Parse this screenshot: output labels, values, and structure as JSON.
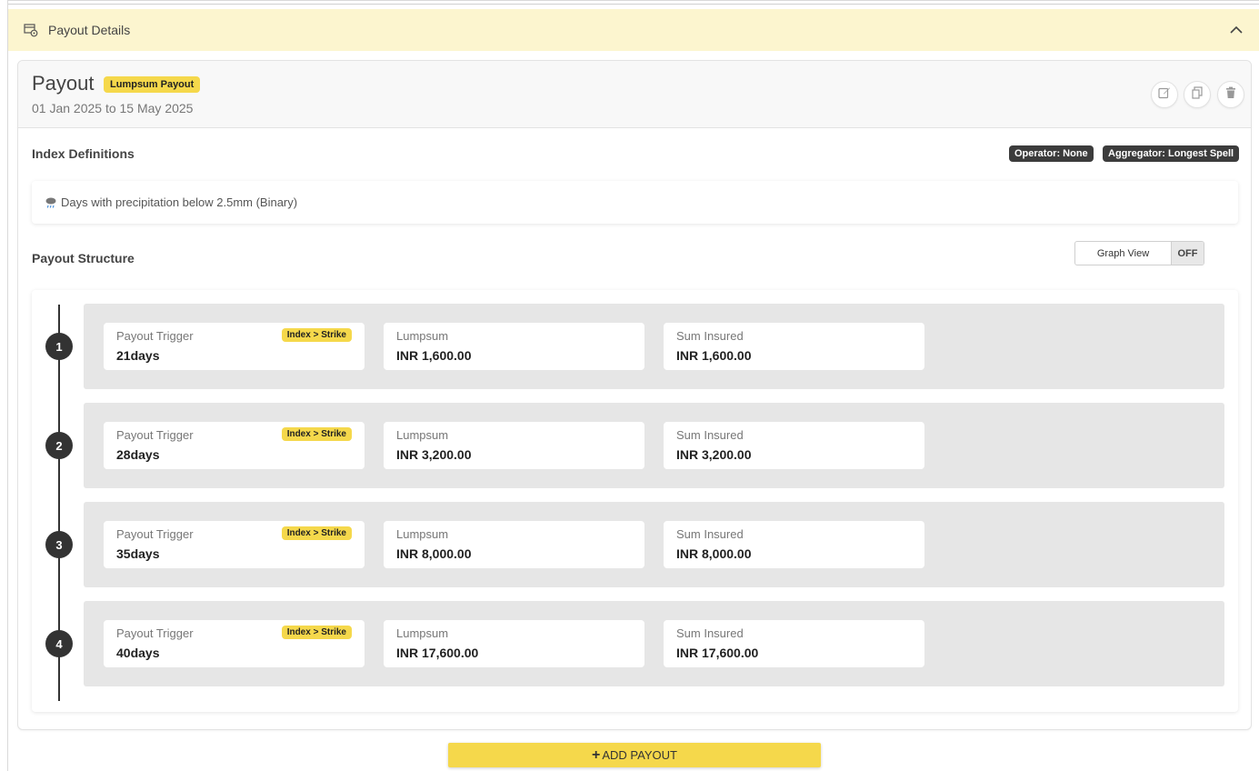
{
  "section": {
    "title": "Payout Details",
    "icon": "payout-settings-icon",
    "collapse_icon": "chevron-up-icon"
  },
  "payout": {
    "title": "Payout",
    "type_badge": "Lumpsum Payout",
    "date_range": "01 Jan 2025 to 15 May 2025",
    "actions": [
      {
        "name": "edit",
        "icon": "edit-icon"
      },
      {
        "name": "duplicate",
        "icon": "copy-icon"
      },
      {
        "name": "delete",
        "icon": "trash-icon"
      }
    ]
  },
  "index_definitions": {
    "title": "Index Definitions",
    "operator_badge": "Operator: None",
    "aggregator_badge": "Aggregator: Longest Spell",
    "definition_text": "Days with precipitation below 2.5mm (Binary)",
    "definition_icon": "rain-cloud-icon"
  },
  "payout_structure": {
    "title": "Payout Structure",
    "graph_view_label": "Graph View",
    "graph_view_state": "OFF",
    "field_labels": {
      "trigger": "Payout Trigger",
      "lumpsum": "Lumpsum",
      "sum_insured": "Sum Insured"
    },
    "trigger_badge": "Index > Strike",
    "tiers": [
      {
        "step": "1",
        "trigger": "21days",
        "lumpsum": "INR 1,600.00",
        "sum_insured": "INR 1,600.00"
      },
      {
        "step": "2",
        "trigger": "28days",
        "lumpsum": "INR 3,200.00",
        "sum_insured": "INR 3,200.00"
      },
      {
        "step": "3",
        "trigger": "35days",
        "lumpsum": "INR 8,000.00",
        "sum_insured": "INR 8,000.00"
      },
      {
        "step": "4",
        "trigger": "40days",
        "lumpsum": "INR 17,600.00",
        "sum_insured": "INR 17,600.00"
      }
    ]
  },
  "add_payout_label": "ADD PAYOUT",
  "colors": {
    "accent": "#f5d84b",
    "header_bg": "#fcf5cf",
    "dark_badge": "#3c3c3c",
    "tier_bg": "#e6e6e6"
  }
}
